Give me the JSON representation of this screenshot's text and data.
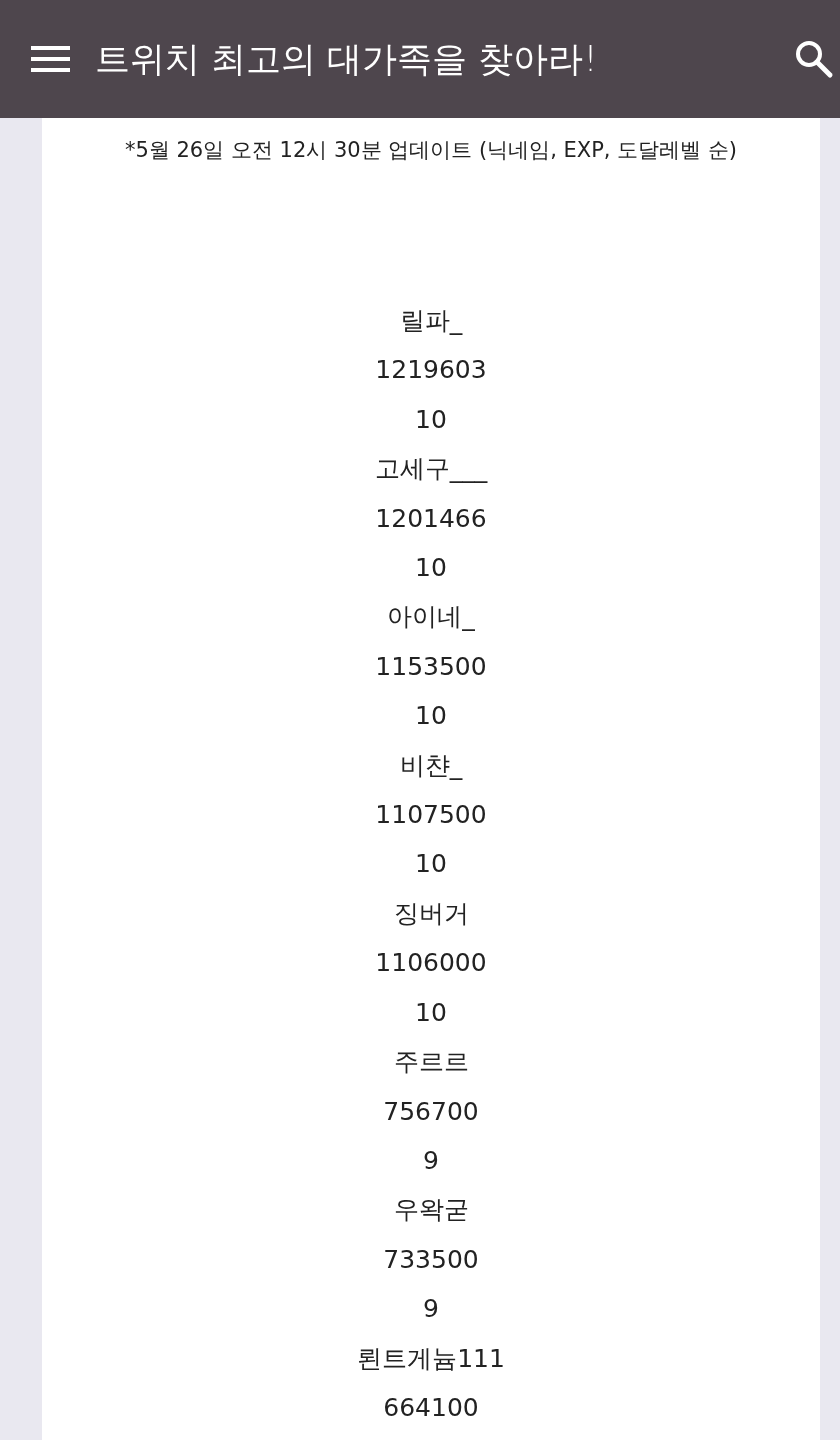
{
  "app_bar": {
    "title": "트위치 최고의 대가족을 찾아라!"
  },
  "update_note": "*5월 26일 오전 12시 30분 업데이트  (닉네임, EXP, 도달레벨 순)",
  "entries": [
    {
      "nickname": "릴파_",
      "exp": "1219603",
      "level": "10"
    },
    {
      "nickname": "고세구___",
      "exp": "1201466",
      "level": "10"
    },
    {
      "nickname": "아이네_",
      "exp": "1153500",
      "level": "10"
    },
    {
      "nickname": "비챤_",
      "exp": "1107500",
      "level": "10"
    },
    {
      "nickname": "징버거",
      "exp": "1106000",
      "level": "10"
    },
    {
      "nickname": "주르르",
      "exp": "756700",
      "level": "9"
    },
    {
      "nickname": "우왁굳",
      "exp": "733500",
      "level": "9"
    },
    {
      "nickname": "뢴트게늄111",
      "exp": "664100"
    }
  ]
}
